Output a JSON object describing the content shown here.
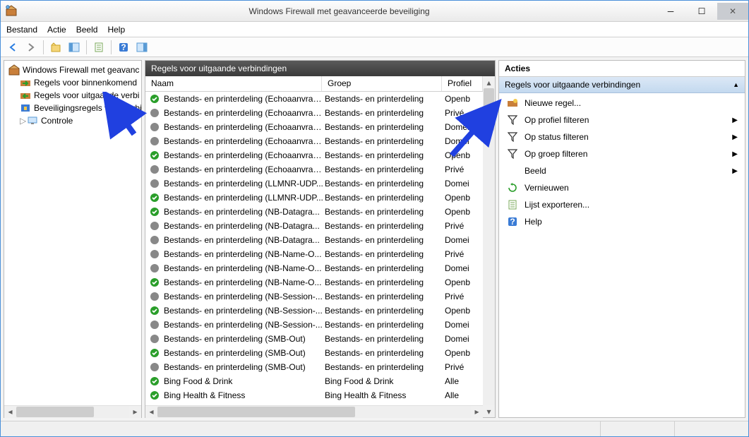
{
  "window": {
    "title": "Windows Firewall met geavanceerde beveiliging"
  },
  "menu": {
    "file": "Bestand",
    "action": "Actie",
    "view": "Beeld",
    "help": "Help"
  },
  "tree": {
    "root": "Windows Firewall met geavanc",
    "inbound": "Regels voor binnenkomend",
    "outbound": "Regels voor uitgaande verbi",
    "security": "Beveiligingsregels voor verbi",
    "monitor": "Controle"
  },
  "center": {
    "title": "Regels voor uitgaande verbindingen",
    "columns": {
      "name": "Naam",
      "group": "Groep",
      "profile": "Profiel"
    },
    "rows": [
      {
        "enabled": true,
        "name": "Bestands- en printerdeling (Echoaanvraa...",
        "group": "Bestands- en printerdeling",
        "profile": "Openb"
      },
      {
        "enabled": false,
        "name": "Bestands- en printerdeling (Echoaanvraa...",
        "group": "Bestands- en printerdeling",
        "profile": "Privé"
      },
      {
        "enabled": false,
        "name": "Bestands- en printerdeling (Echoaanvraa...",
        "group": "Bestands- en printerdeling",
        "profile": "Domei"
      },
      {
        "enabled": false,
        "name": "Bestands- en printerdeling (Echoaanvraa...",
        "group": "Bestands- en printerdeling",
        "profile": "Domei"
      },
      {
        "enabled": true,
        "name": "Bestands- en printerdeling (Echoaanvraa...",
        "group": "Bestands- en printerdeling",
        "profile": "Openb"
      },
      {
        "enabled": false,
        "name": "Bestands- en printerdeling (Echoaanvraa...",
        "group": "Bestands- en printerdeling",
        "profile": "Privé"
      },
      {
        "enabled": false,
        "name": "Bestands- en printerdeling (LLMNR-UDP...",
        "group": "Bestands- en printerdeling",
        "profile": "Domei"
      },
      {
        "enabled": true,
        "name": "Bestands- en printerdeling (LLMNR-UDP...",
        "group": "Bestands- en printerdeling",
        "profile": "Openb"
      },
      {
        "enabled": true,
        "name": "Bestands- en printerdeling (NB-Datagra...",
        "group": "Bestands- en printerdeling",
        "profile": "Openb"
      },
      {
        "enabled": false,
        "name": "Bestands- en printerdeling (NB-Datagra...",
        "group": "Bestands- en printerdeling",
        "profile": "Privé"
      },
      {
        "enabled": false,
        "name": "Bestands- en printerdeling (NB-Datagra...",
        "group": "Bestands- en printerdeling",
        "profile": "Domei"
      },
      {
        "enabled": false,
        "name": "Bestands- en printerdeling (NB-Name-O...",
        "group": "Bestands- en printerdeling",
        "profile": "Privé"
      },
      {
        "enabled": false,
        "name": "Bestands- en printerdeling (NB-Name-O...",
        "group": "Bestands- en printerdeling",
        "profile": "Domei"
      },
      {
        "enabled": true,
        "name": "Bestands- en printerdeling (NB-Name-O...",
        "group": "Bestands- en printerdeling",
        "profile": "Openb"
      },
      {
        "enabled": false,
        "name": "Bestands- en printerdeling (NB-Session-...",
        "group": "Bestands- en printerdeling",
        "profile": "Privé"
      },
      {
        "enabled": true,
        "name": "Bestands- en printerdeling (NB-Session-...",
        "group": "Bestands- en printerdeling",
        "profile": "Openb"
      },
      {
        "enabled": false,
        "name": "Bestands- en printerdeling (NB-Session-...",
        "group": "Bestands- en printerdeling",
        "profile": "Domei"
      },
      {
        "enabled": false,
        "name": "Bestands- en printerdeling (SMB-Out)",
        "group": "Bestands- en printerdeling",
        "profile": "Domei"
      },
      {
        "enabled": true,
        "name": "Bestands- en printerdeling (SMB-Out)",
        "group": "Bestands- en printerdeling",
        "profile": "Openb"
      },
      {
        "enabled": false,
        "name": "Bestands- en printerdeling (SMB-Out)",
        "group": "Bestands- en printerdeling",
        "profile": "Privé"
      },
      {
        "enabled": true,
        "name": "Bing Food & Drink",
        "group": "Bing Food & Drink",
        "profile": "Alle"
      },
      {
        "enabled": true,
        "name": "Bing Health & Fitness",
        "group": "Bing Health & Fitness",
        "profile": "Alle"
      }
    ]
  },
  "actions": {
    "title": "Acties",
    "subtitle": "Regels voor uitgaande verbindingen",
    "new_rule": "Nieuwe regel...",
    "filter_profile": "Op profiel filteren",
    "filter_status": "Op status filteren",
    "filter_group": "Op groep filteren",
    "view": "Beeld",
    "refresh": "Vernieuwen",
    "export": "Lijst exporteren...",
    "help": "Help"
  }
}
